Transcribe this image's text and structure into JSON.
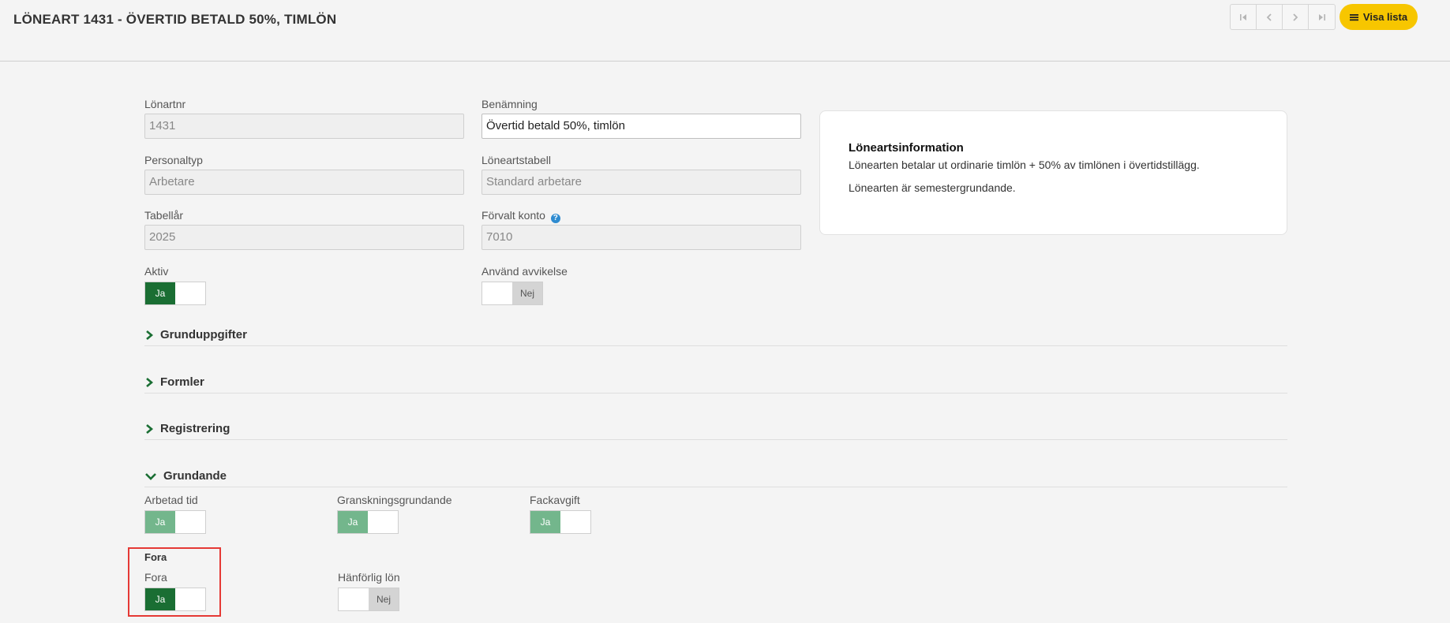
{
  "header": {
    "title": "LÖNEART 1431 - ÖVERTID BETALD 50%, TIMLÖN",
    "nav": {
      "first_icon": "first-page-icon",
      "prev_icon": "chevron-left-icon",
      "next_icon": "chevron-right-icon",
      "last_icon": "last-page-icon"
    },
    "visa_lista": "Visa lista"
  },
  "fields": {
    "lonartnr": {
      "label": "Lönartnr",
      "value": "1431"
    },
    "benamning": {
      "label": "Benämning",
      "value": "Övertid betald 50%, timlön"
    },
    "personaltyp": {
      "label": "Personaltyp",
      "value": "Arbetare"
    },
    "loneartstabell": {
      "label": "Löneartstabell",
      "value": "Standard arbetare"
    },
    "tabellar": {
      "label": "Tabellår",
      "value": "2025"
    },
    "forvalt_konto": {
      "label": "Förvalt konto",
      "value": "7010",
      "help": "?"
    }
  },
  "toggles": {
    "aktiv": {
      "label": "Aktiv",
      "text": "Ja"
    },
    "anvand_avvikelse": {
      "label": "Använd avvikelse",
      "text": "Nej"
    },
    "arbetad_tid": {
      "label": "Arbetad tid",
      "text": "Ja"
    },
    "gransknings": {
      "label": "Granskningsgrundande",
      "text": "Ja"
    },
    "fackavgift": {
      "label": "Fackavgift",
      "text": "Ja"
    },
    "fora": {
      "label": "Fora",
      "text": "Ja"
    },
    "hanforlig_lon": {
      "label": "Hänförlig lön",
      "text": "Nej"
    }
  },
  "info": {
    "title": "Löneartsinformation",
    "line1": "Lönearten betalar ut ordinarie timlön + 50% av timlönen i övertidstillägg.",
    "line2": "Lönearten är semestergrundande."
  },
  "sections": {
    "grunduppgifter": "Grunduppgifter",
    "formler": "Formler",
    "registrering": "Registrering",
    "grundande": "Grundande",
    "fora_heading": "Fora"
  },
  "colors": {
    "accent_green": "#1a6e33",
    "light_green": "#73b68c",
    "brand_yellow": "#f7c600",
    "highlight_red": "#e53935"
  }
}
